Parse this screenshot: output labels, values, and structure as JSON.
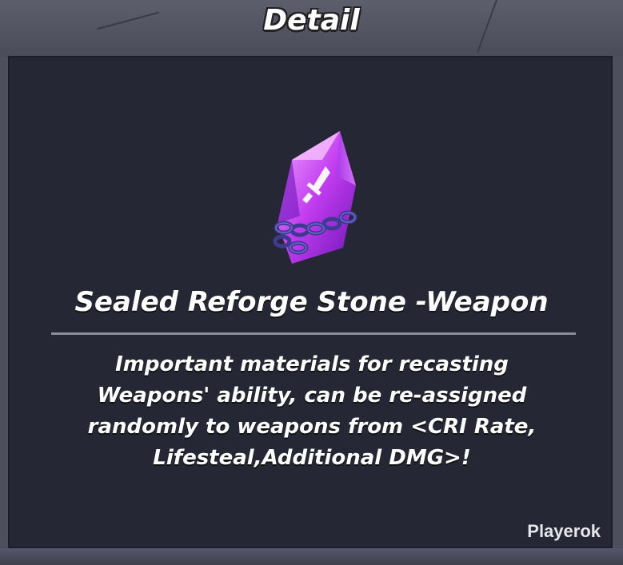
{
  "header": {
    "title": "Detail"
  },
  "item": {
    "name": "Sealed Reforge Stone -Weapon",
    "description_lines": [
      "Important materials for recasting",
      "Weapons' ability, can be re-assigned",
      "randomly to weapons from <CRI Rate,",
      "Lifesteal,Additional DMG>!"
    ],
    "icon": "sealed-purple-crystal-with-sword-emblem",
    "icon_colors": {
      "crystal_light": "#e67dff",
      "crystal_dark": "#8a1fd1",
      "chain": "#3b3a8c"
    }
  },
  "watermark": "Playerok",
  "colors": {
    "panel": "#252735",
    "frame": "#4a4b58",
    "divider": "#8c8d99"
  }
}
